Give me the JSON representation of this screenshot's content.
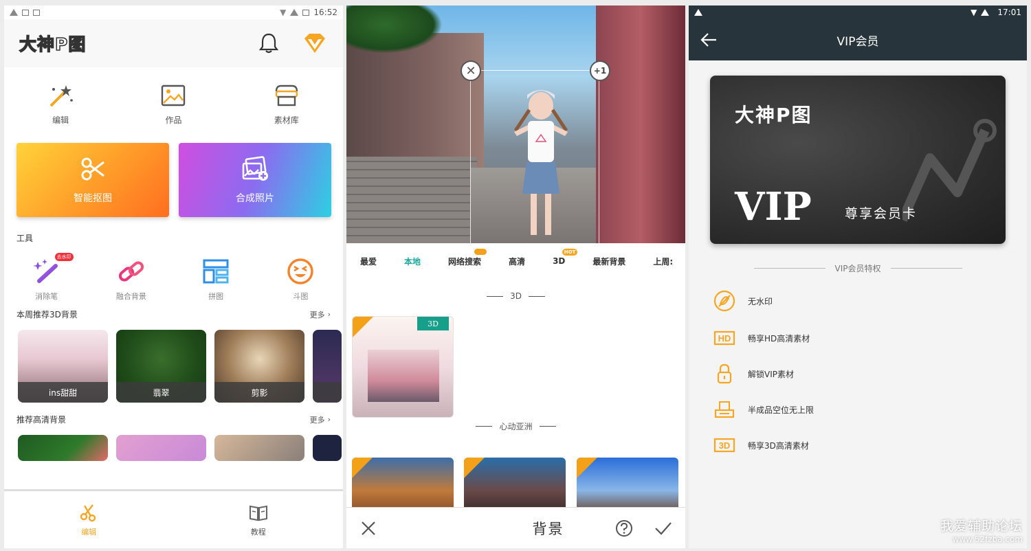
{
  "panel1": {
    "status": {
      "time": "16:52"
    },
    "logo": "大神P图",
    "topnav": [
      {
        "label": "编辑",
        "icon": "magic-wand-icon"
      },
      {
        "label": "作品",
        "icon": "picture-icon"
      },
      {
        "label": "素材库",
        "icon": "store-icon"
      }
    ],
    "cards": [
      {
        "label": "智能抠图",
        "icon": "scissors-icon"
      },
      {
        "label": "合成照片",
        "icon": "photos-plus-icon"
      }
    ],
    "tools_title": "工具",
    "tools": [
      {
        "label": "消除笔",
        "badge": "去水印"
      },
      {
        "label": "融合背景"
      },
      {
        "label": "拼图"
      },
      {
        "label": "斗图"
      }
    ],
    "weekly": {
      "title": "本周推荐3D背景",
      "more": "更多",
      "items": [
        "ins甜甜",
        "翡翠",
        "剪影"
      ]
    },
    "hd": {
      "title": "推荐高清背景",
      "more": "更多"
    },
    "bottom_nav": [
      {
        "label": "编辑"
      },
      {
        "label": "教程"
      }
    ]
  },
  "panel2": {
    "selection": {
      "plus": "+1"
    },
    "categories": [
      {
        "label": "最爱"
      },
      {
        "label": "本地",
        "active": true
      },
      {
        "label": "网络搜索",
        "crown": true
      },
      {
        "label": "高清"
      },
      {
        "label": "3D",
        "hot": "HOT"
      },
      {
        "label": "最新背景"
      },
      {
        "label": "上周:"
      }
    ],
    "section_3d": "3D",
    "badge_3d": "3D",
    "section_asia": "心动亚洲",
    "title": "背景"
  },
  "panel3": {
    "status": {
      "time": "17:01"
    },
    "title": "VIP会员",
    "card": {
      "name": "大神P图",
      "vip": "VIP",
      "sub": "尊享会员卡"
    },
    "privileges_title": "VIP会员特权",
    "privileges": [
      {
        "label": "无水印",
        "icon": "no-watermark-icon"
      },
      {
        "label": "畅享HD高清素材",
        "icon": "hd-icon"
      },
      {
        "label": "解锁VIP素材",
        "icon": "lock-icon"
      },
      {
        "label": "半成品空位无上限",
        "icon": "tray-icon"
      },
      {
        "label": "畅享3D高清素材",
        "icon": "3d-icon"
      }
    ]
  },
  "watermark": {
    "line1": "我爱辅助论坛",
    "line2": "www.52fzba.com"
  },
  "colors": {
    "accent_orange": "#f5a623",
    "accent_teal": "#17a79b",
    "vip_bar": "#28343c"
  }
}
